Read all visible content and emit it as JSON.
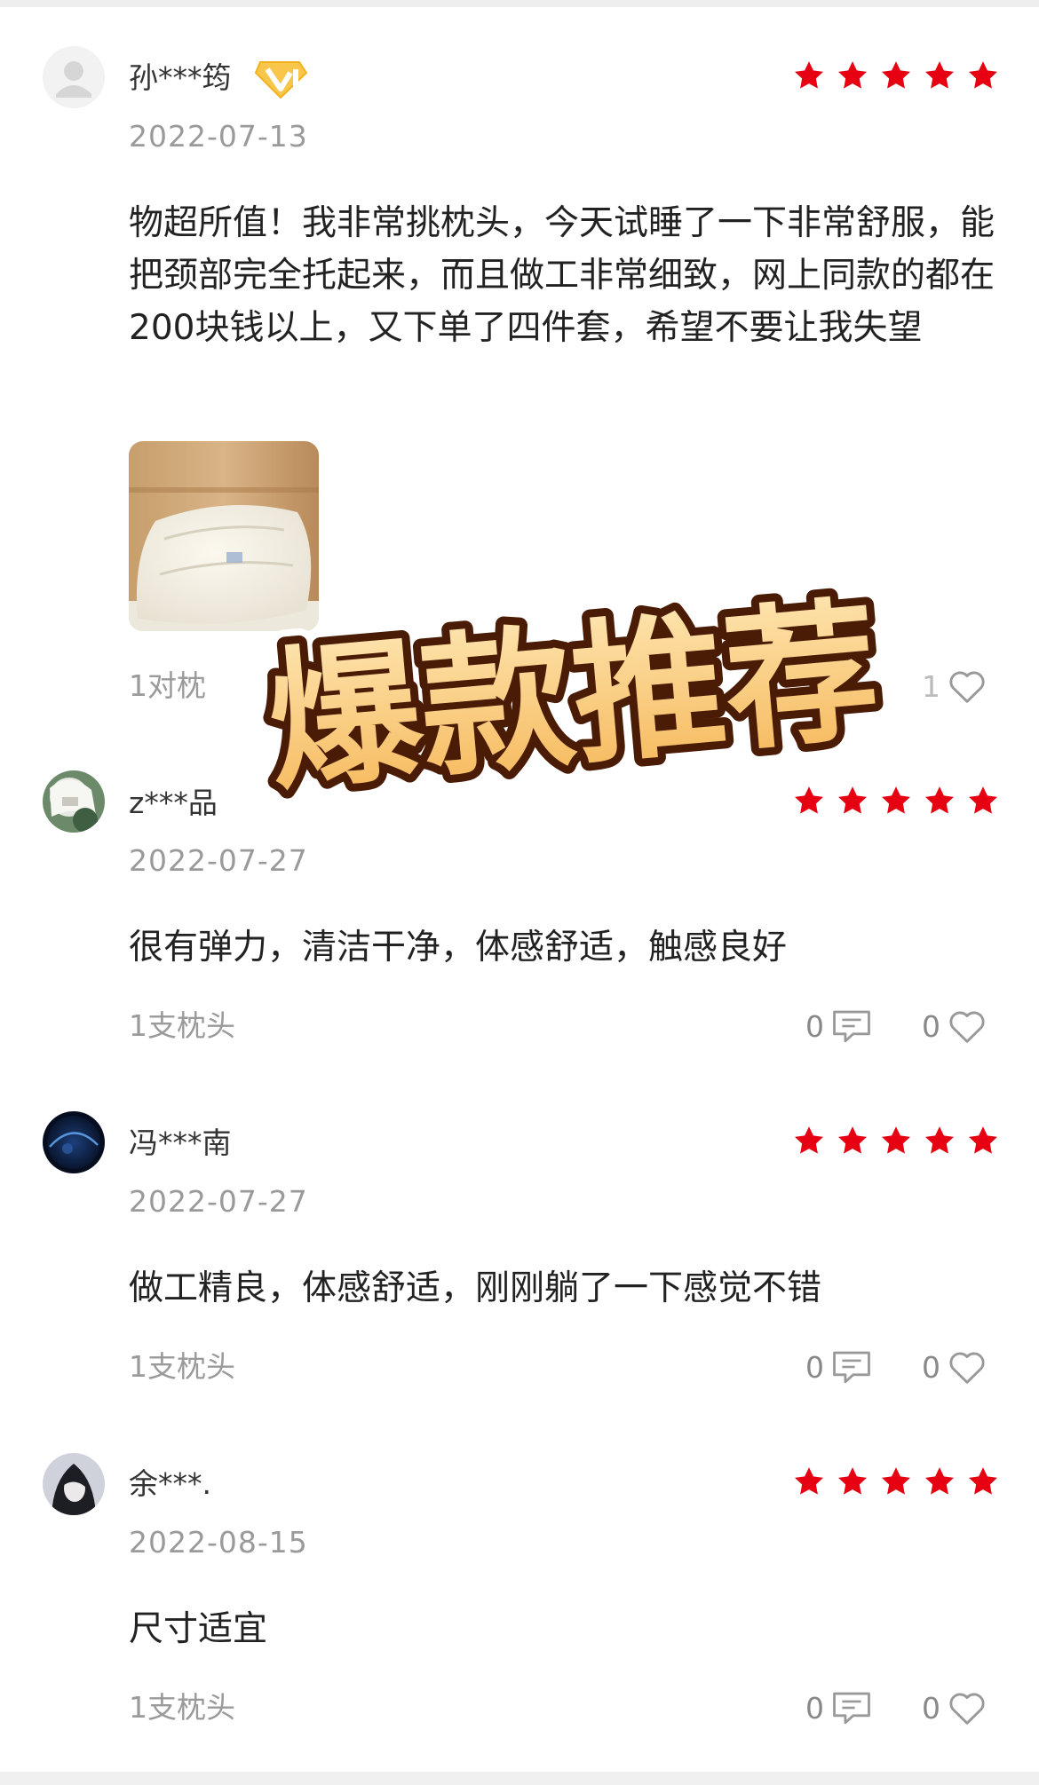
{
  "colors": {
    "star": "#e60012",
    "username": "#333333",
    "muted": "#9a9a9a",
    "text": "#222222",
    "banner_fill": "#fbcf7e",
    "banner_outline": "#4a1c06"
  },
  "banner": {
    "text": "爆款推荐"
  },
  "reviews": [
    {
      "username": "孙***筠",
      "vip_badge": "vip-level-1-badge",
      "rating": 5,
      "date": "2022-07-13",
      "content": "物超所值！我非常挑枕头，今天试睡了一下非常舒服，能把颈部完全托起来，而且做工非常细致，网上同款的都在200块钱以上，又下单了四件套，希望不要让我失望",
      "has_photo": true,
      "spec": "1对枕",
      "comment_count": "",
      "like_count": "1"
    },
    {
      "username": "z***品",
      "rating": 5,
      "date": "2022-07-27",
      "content": "很有弹力，清洁干净，体感舒适，触感良好",
      "spec": "1支枕头",
      "comment_count": "0",
      "like_count": "0"
    },
    {
      "username": "冯***南",
      "rating": 5,
      "date": "2022-07-27",
      "content": "做工精良，体感舒适，刚刚躺了一下感觉不错",
      "spec": "1支枕头",
      "comment_count": "0",
      "like_count": "0"
    },
    {
      "username": "余***.",
      "rating": 5,
      "date": "2022-08-15",
      "content": "尺寸适宜",
      "spec": "1支枕头",
      "comment_count": "0",
      "like_count": "0"
    }
  ]
}
